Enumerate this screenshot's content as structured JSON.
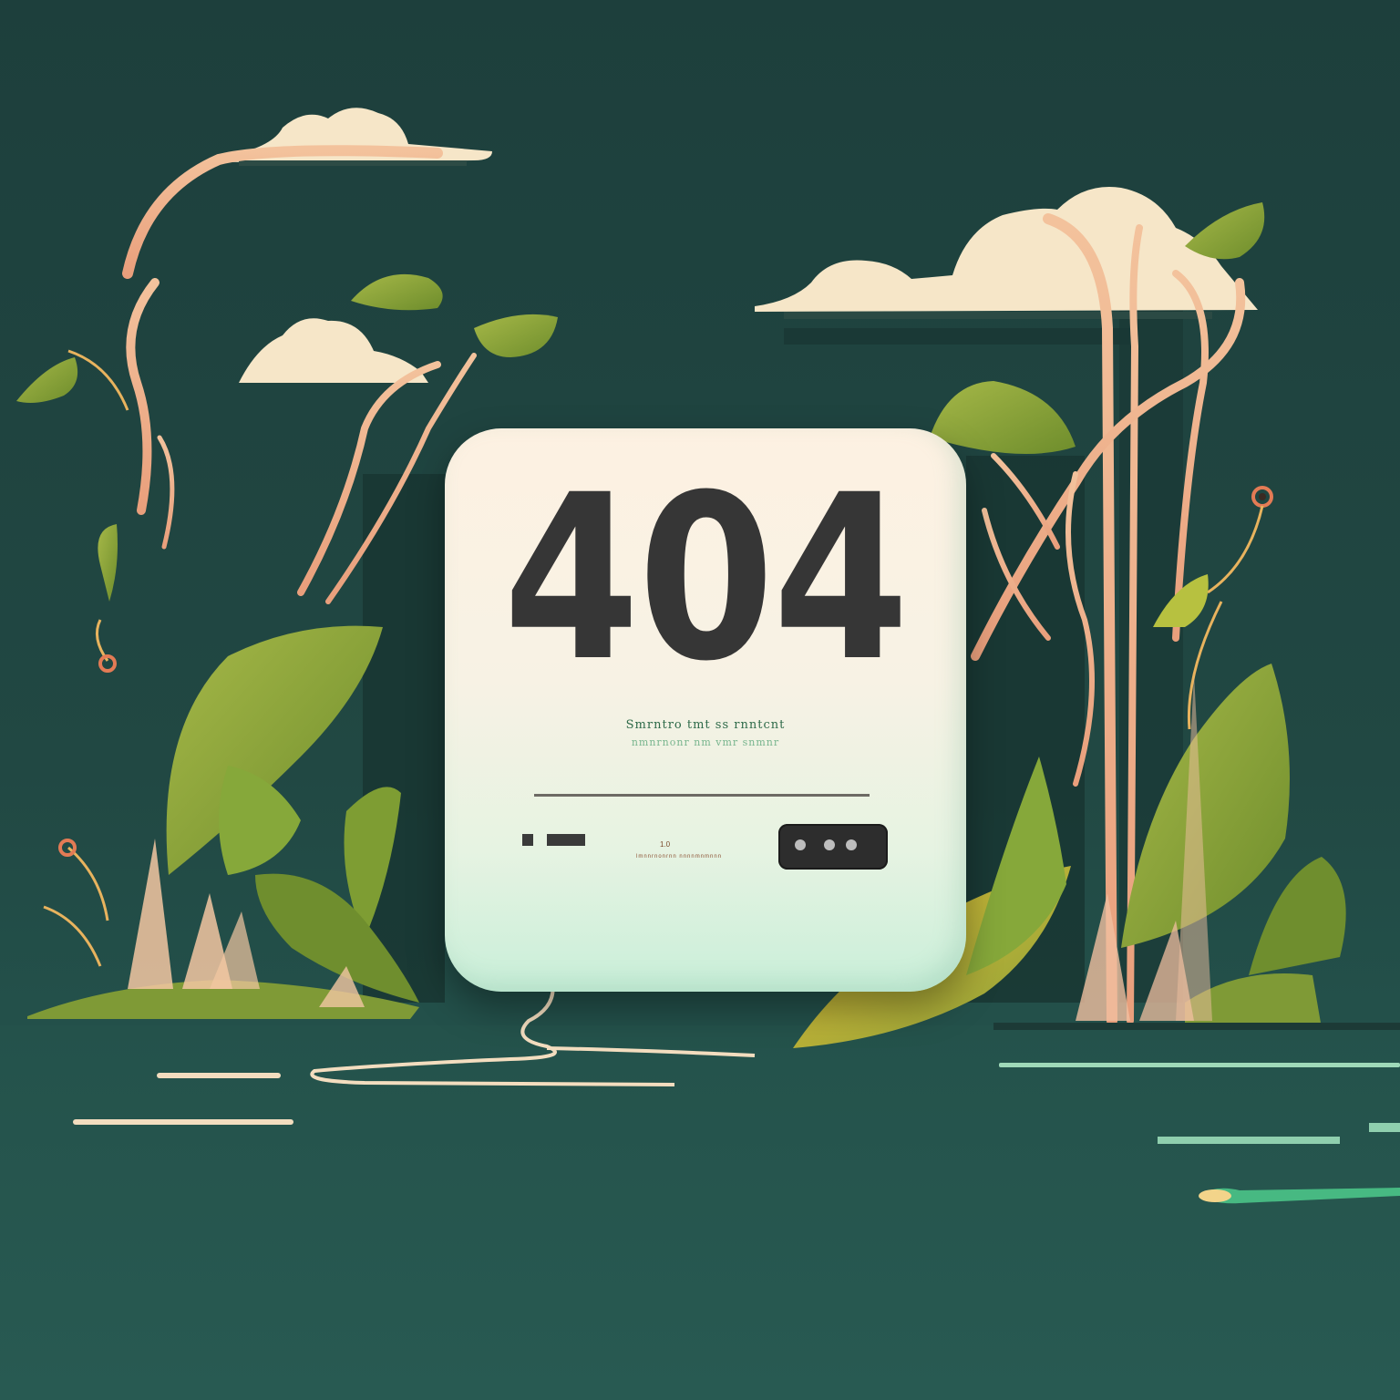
{
  "card": {
    "error_code": "404",
    "message_line_1": "Smrntro tmt ss rnntcnt",
    "message_line_2": "nmnrnonr nm vmr snmnr",
    "small_label": "1.0",
    "small_text": "lmnnrnonrnn nnnnmnmnnn"
  },
  "colors": {
    "background": "#1f4440",
    "card": "#f7f2e4",
    "digits": "#363636",
    "leaf": "#86a83a",
    "stem": "#f0b48c",
    "cloud": "#f6e6c8"
  },
  "icons": {
    "port": "ethernet-port-icon"
  }
}
